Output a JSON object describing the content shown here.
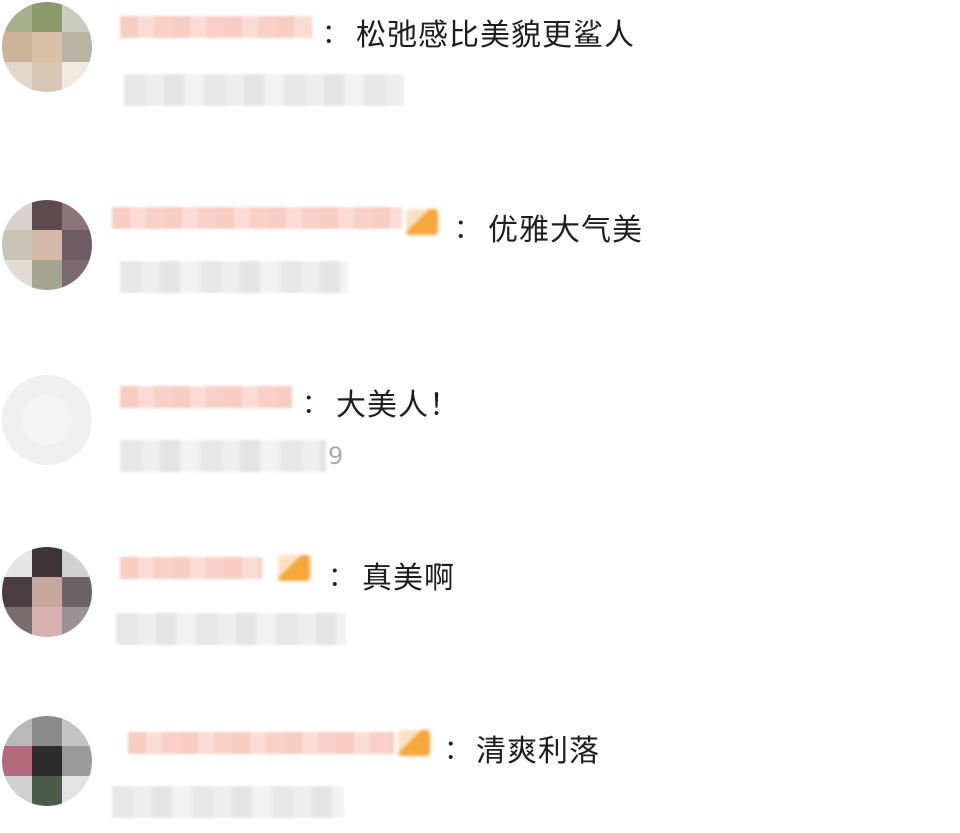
{
  "comments": [
    {
      "text": "松弛感比美貌更鲨人",
      "meta_tail": ""
    },
    {
      "text": "优雅大气美",
      "meta_tail": ""
    },
    {
      "text": "大美人！",
      "meta_tail": "9"
    },
    {
      "text": "真美啊",
      "meta_tail": ""
    },
    {
      "text": "清爽利落",
      "meta_tail": ""
    }
  ],
  "separator": "：",
  "icons": {
    "avatar": "blurred-avatar",
    "badge": "blurred-badge-icon"
  },
  "colors": {
    "name_blur": "#f7c7bc",
    "badge": "#f5a73a",
    "meta_blur": "#e6e6e6",
    "text": "#1e1e1e"
  }
}
